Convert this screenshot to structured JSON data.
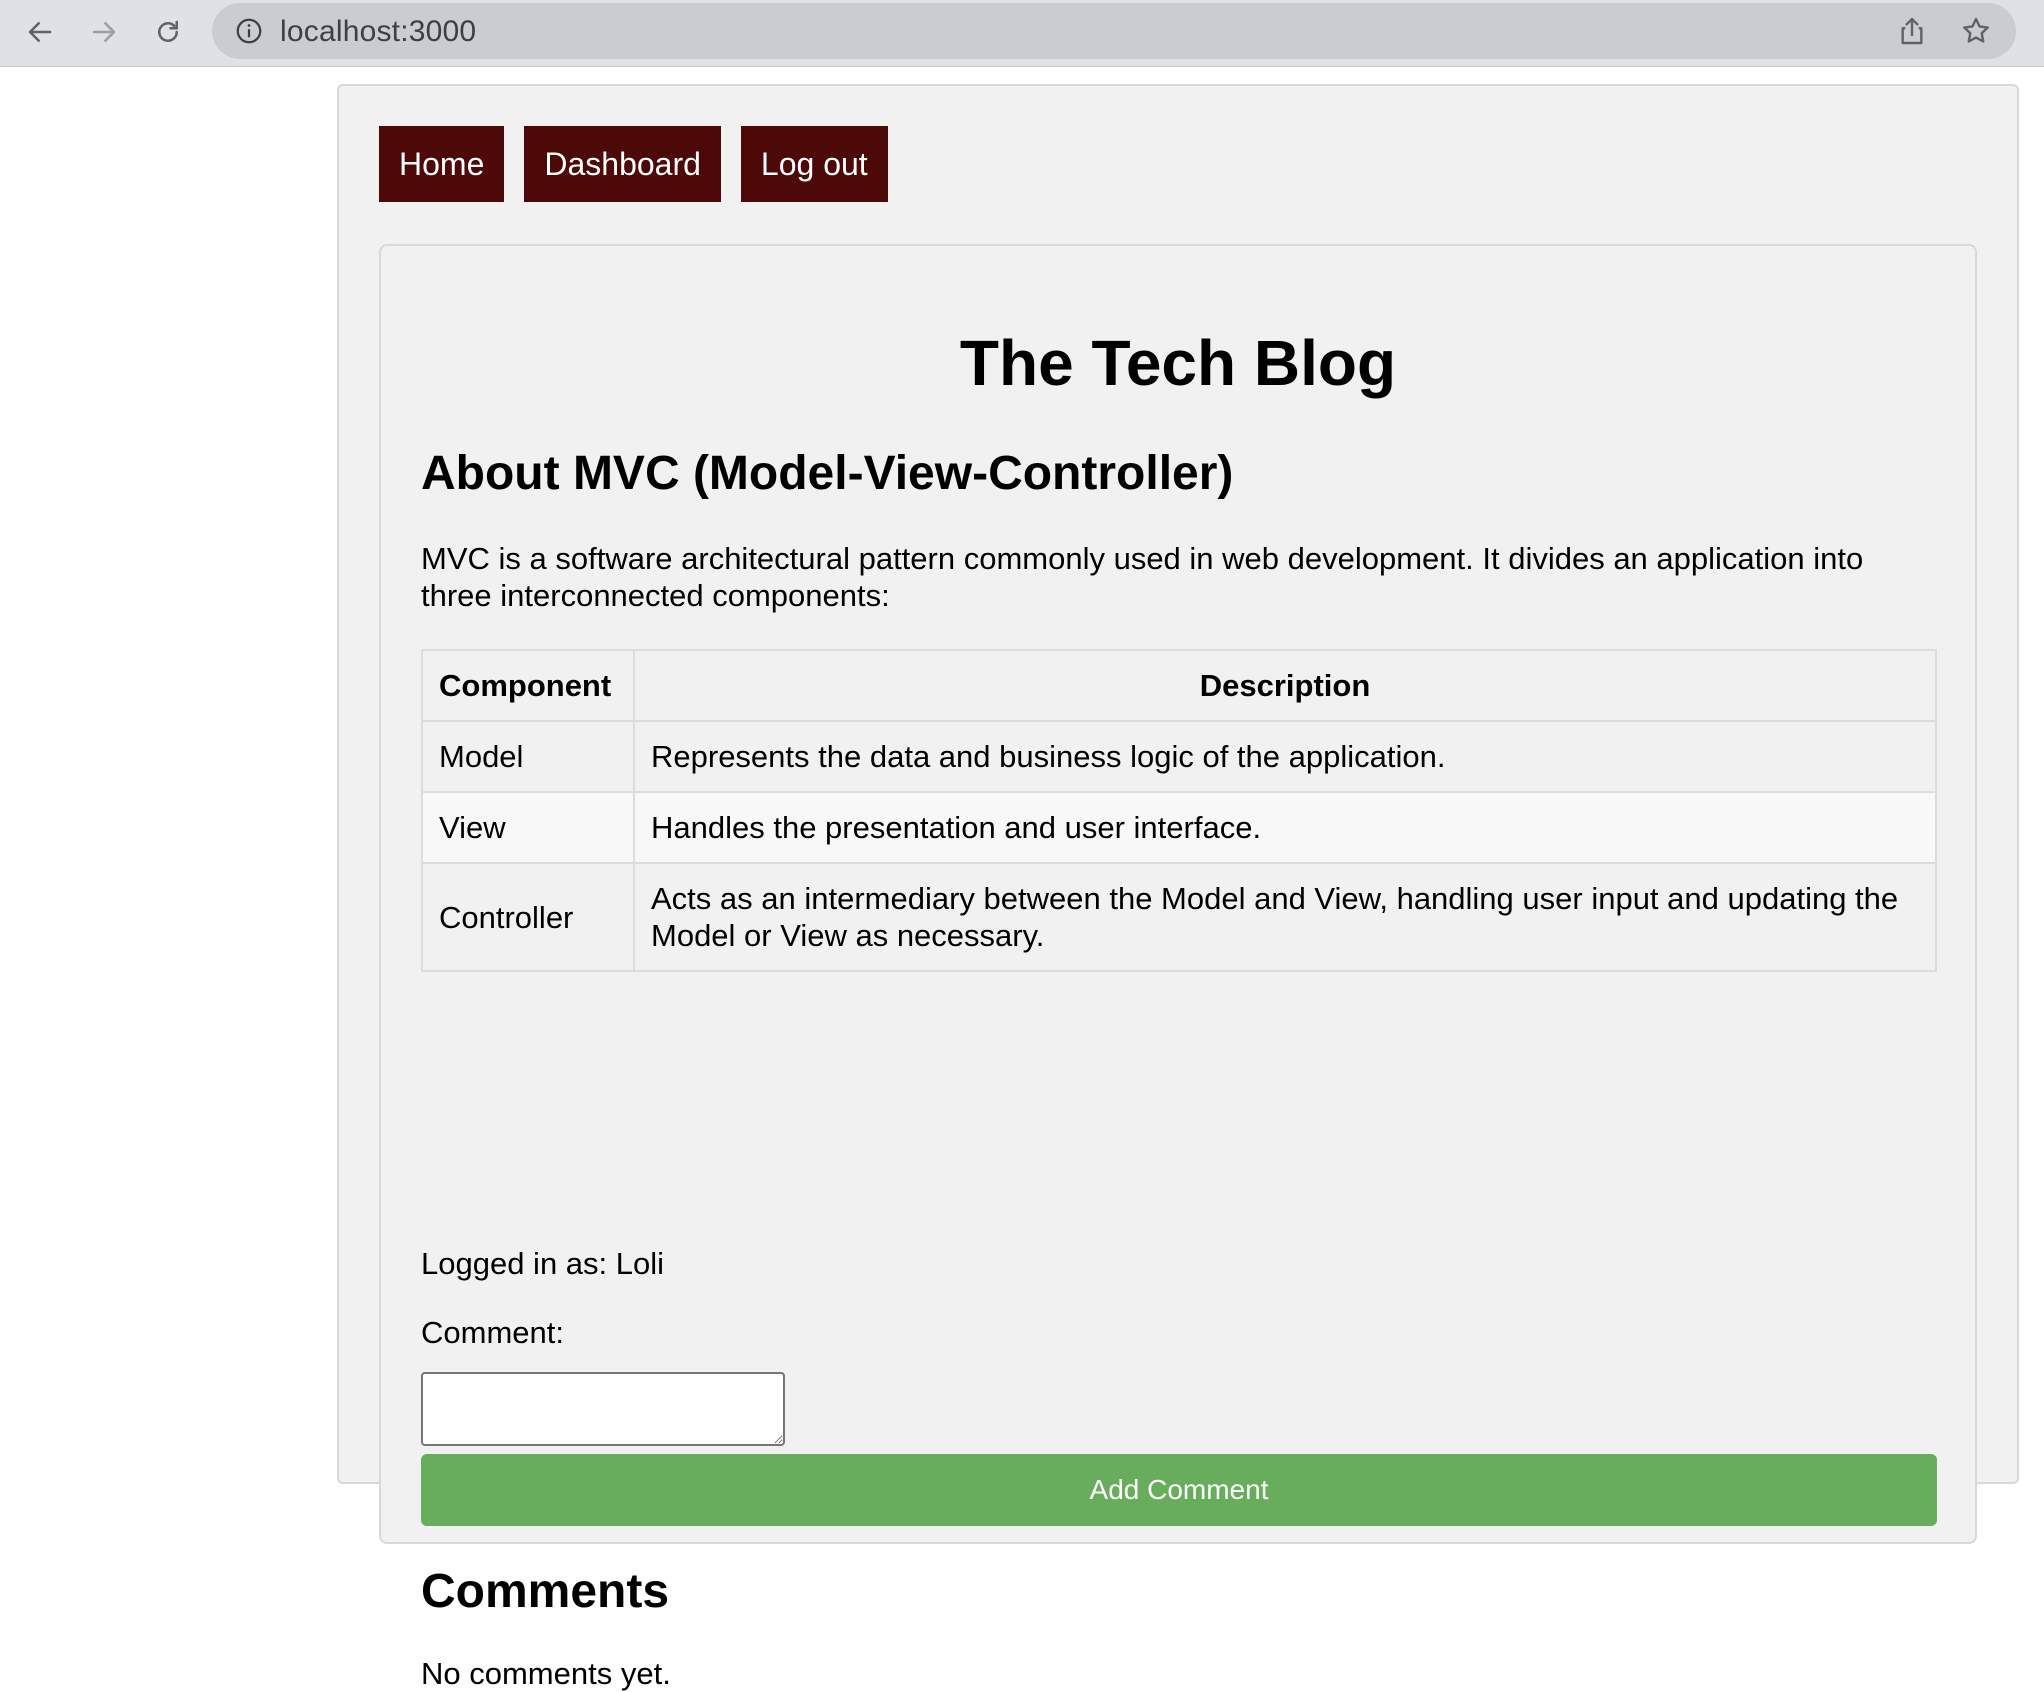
{
  "browser": {
    "url": "localhost:3000",
    "icons": {
      "back": "arrow-left-icon",
      "forward": "arrow-right-icon",
      "reload": "reload-icon",
      "site_info": "info-icon",
      "share": "share-icon",
      "bookmark": "star-icon"
    }
  },
  "nav": {
    "home": "Home",
    "dashboard": "Dashboard",
    "logout": "Log out"
  },
  "site": {
    "title": "The Tech Blog"
  },
  "post": {
    "title": "About MVC (Model-View-Controller)",
    "body": "MVC is a software architectural pattern commonly used in web development. It divides an application into three interconnected components:",
    "table": {
      "headers": [
        "Component",
        "Description"
      ],
      "rows": [
        [
          "Model",
          "Represents the data and business logic of the application."
        ],
        [
          "View",
          "Handles the presentation and user interface."
        ],
        [
          "Controller",
          "Acts as an intermediary between the Model and View, handling user input and updating the Model or View as necessary."
        ]
      ]
    }
  },
  "comment_form": {
    "logged_in": "Logged in as: Loli",
    "label": "Comment:",
    "value": "",
    "submit": "Add Comment"
  },
  "comments": {
    "heading": "Comments",
    "empty": "No comments yet."
  },
  "colors": {
    "nav_button": "#4d0808",
    "submit_button": "#67ad5b",
    "page_bg": "#f1f1f1"
  }
}
